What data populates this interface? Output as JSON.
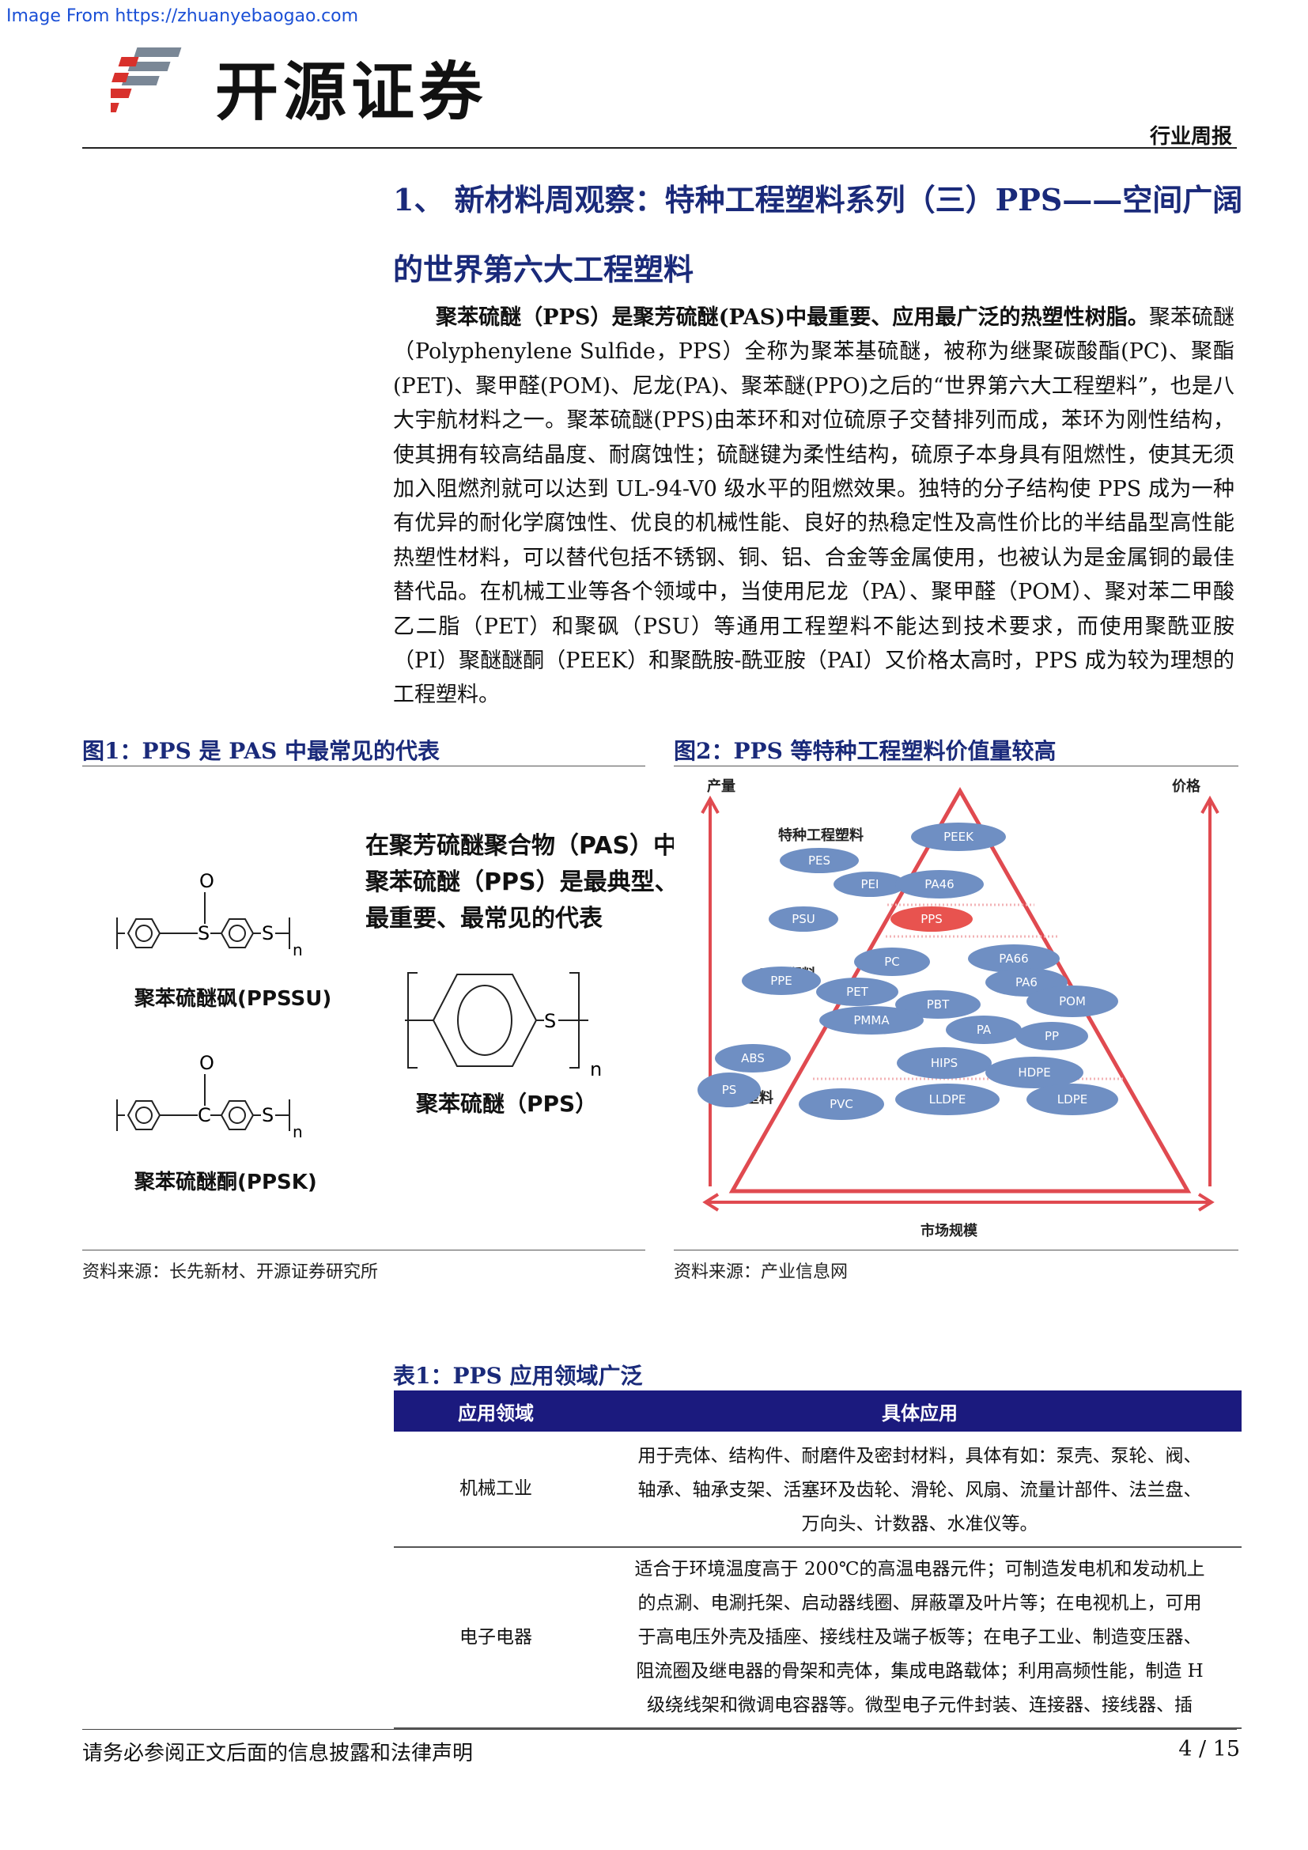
{
  "watermark": "Image From https://zhuanyebaogao.com",
  "header": {
    "logo_text": "开源证券",
    "report_type": "行业周报"
  },
  "section": {
    "title_line1": "1、 新材料周观察：特种工程塑料系列（三）PPS——空间广阔",
    "title_line2": "的世界第六大工程塑料",
    "paragraph_bold": "聚苯硫醚（PPS）是聚芳硫醚(PAS)中最重要、应用最广泛的热塑性树脂。",
    "paragraph_rest": "聚苯硫醚（Polyphenylene Sulfide，PPS）全称为聚苯基硫醚，被称为继聚碳酸酯(PC)、聚酯(PET)、聚甲醛(POM)、尼龙(PA)、聚苯醚(PPO)之后的“世界第六大工程塑料”，也是八大宇航材料之一。聚苯硫醚(PPS)由苯环和对位硫原子交替排列而成，苯环为刚性结构，使其拥有较高结晶度、耐腐蚀性；硫醚键为柔性结构，硫原子本身具有阻燃性，使其无须加入阻燃剂就可以达到 UL-94-V0 级水平的阻燃效果。独特的分子结构使 PPS 成为一种有优异的耐化学腐蚀性、优良的机械性能、良好的热稳定性及高性价比的半结晶型高性能热塑性材料，可以替代包括不锈钢、铜、铝、合金等金属使用，也被认为是金属铜的最佳替代品。在机械工业等各个领域中，当使用尼龙（PA）、聚甲醛（POM）、聚对苯二甲酸乙二脂（PET）和聚砜（PSU）等通用工程塑料不能达到技术要求，而使用聚酰亚胺（PI）聚醚醚酮（PEEK）和聚酰胺-酰亚胺（PAI）又价格太高时，PPS 成为较为理想的工程塑料。"
  },
  "figure1": {
    "title": "图1：PPS 是 PAS 中最常见的代表",
    "caption_l1": "在聚芳硫醚聚合物（PAS）中，",
    "caption_l2": "聚苯硫醚（PPS）是最典型、",
    "caption_l3": "最重要、最常见的代表",
    "mol1_label": "聚苯硫醚砜(PPSSU)",
    "mol2_label": "聚苯硫醚酮(PPSK)",
    "mol3_label": "聚苯硫醚（PPS）",
    "atom_o": "O",
    "atom_s": "S",
    "atom_c": "C",
    "sub_n": "n",
    "source": "资料来源：长先新材、开源证券研究所"
  },
  "figure2": {
    "title": "图2：PPS 等特种工程塑料价值量较高",
    "axis_left": "产量",
    "axis_right": "价格",
    "axis_bottom": "市场规模",
    "tier_special": "特种工程塑料",
    "tier_engineering": "工程塑料",
    "tier_general": "普通塑料",
    "bubbles": {
      "peek": "PEEK",
      "pes": "PES",
      "pei": "PEI",
      "pa46": "PA46",
      "psu": "PSU",
      "pps": "PPS",
      "pc": "PC",
      "pa66": "PA66",
      "ppe": "PPE",
      "pet": "PET",
      "pa6": "PA6",
      "pbt": "PBT",
      "pom": "POM",
      "pmma": "PMMA",
      "pa": "PA",
      "pp": "PP",
      "abs": "ABS",
      "hips": "HIPS",
      "hdpe": "HDPE",
      "ps": "PS",
      "pvc": "PVC",
      "lldpe": "LLDPE",
      "ldpe": "LDPE"
    },
    "colors": {
      "bubble": "#6f8fc3",
      "highlight": "#e8534f",
      "frame": "#d9454a"
    },
    "source": "资料来源：产业信息网"
  },
  "table1": {
    "title": "表1：PPS 应用领域广泛",
    "headers": [
      "应用领域",
      "具体应用"
    ],
    "rows": [
      {
        "field": "机械工业",
        "line1": "用于壳体、结构件、耐磨件及密封材料，具体有如：泵壳、泵轮、阀、",
        "line2": "轴承、轴承支架、活塞环及齿轮、滑轮、风扇、流量计部件、法兰盘、",
        "line3": "万向头、计数器、水准仪等。"
      },
      {
        "field": "电子电器",
        "line1": "适合于环境温度高于 200℃的高温电器元件；可制造发电机和发动机上",
        "line2": "的点涮、电涮托架、启动器线圈、屏蔽罩及叶片等；在电视机上，可用",
        "line3": "于高电压外壳及插座、接线柱及端子板等；在电子工业、制造变压器、",
        "line4": "阻流圈及继电器的骨架和壳体，集成电路载体；利用高频性能，制造 H",
        "line5": "级绕线架和微调电容器等。微型电子元件封装、连接器、接线器、插"
      }
    ]
  },
  "footer": {
    "disclaimer": "请务必参阅正文后面的信息披露和法律声明",
    "page": "4 / 15"
  }
}
